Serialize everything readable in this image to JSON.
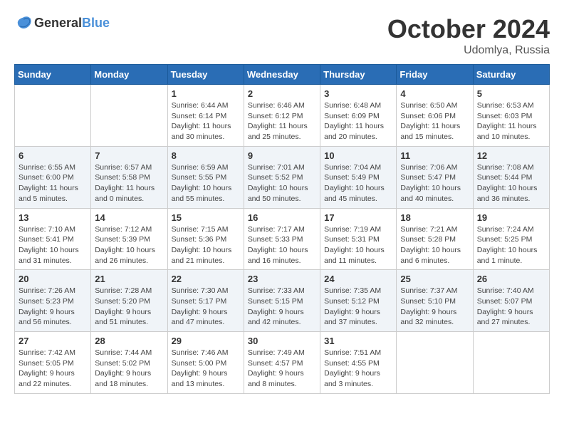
{
  "header": {
    "logo_general": "General",
    "logo_blue": "Blue",
    "month_title": "October 2024",
    "location": "Udomlya, Russia"
  },
  "days_of_week": [
    "Sunday",
    "Monday",
    "Tuesday",
    "Wednesday",
    "Thursday",
    "Friday",
    "Saturday"
  ],
  "weeks": [
    [
      {
        "day": "",
        "info": ""
      },
      {
        "day": "",
        "info": ""
      },
      {
        "day": "1",
        "info": "Sunrise: 6:44 AM\nSunset: 6:14 PM\nDaylight: 11 hours and 30 minutes."
      },
      {
        "day": "2",
        "info": "Sunrise: 6:46 AM\nSunset: 6:12 PM\nDaylight: 11 hours and 25 minutes."
      },
      {
        "day": "3",
        "info": "Sunrise: 6:48 AM\nSunset: 6:09 PM\nDaylight: 11 hours and 20 minutes."
      },
      {
        "day": "4",
        "info": "Sunrise: 6:50 AM\nSunset: 6:06 PM\nDaylight: 11 hours and 15 minutes."
      },
      {
        "day": "5",
        "info": "Sunrise: 6:53 AM\nSunset: 6:03 PM\nDaylight: 11 hours and 10 minutes."
      }
    ],
    [
      {
        "day": "6",
        "info": "Sunrise: 6:55 AM\nSunset: 6:00 PM\nDaylight: 11 hours and 5 minutes."
      },
      {
        "day": "7",
        "info": "Sunrise: 6:57 AM\nSunset: 5:58 PM\nDaylight: 11 hours and 0 minutes."
      },
      {
        "day": "8",
        "info": "Sunrise: 6:59 AM\nSunset: 5:55 PM\nDaylight: 10 hours and 55 minutes."
      },
      {
        "day": "9",
        "info": "Sunrise: 7:01 AM\nSunset: 5:52 PM\nDaylight: 10 hours and 50 minutes."
      },
      {
        "day": "10",
        "info": "Sunrise: 7:04 AM\nSunset: 5:49 PM\nDaylight: 10 hours and 45 minutes."
      },
      {
        "day": "11",
        "info": "Sunrise: 7:06 AM\nSunset: 5:47 PM\nDaylight: 10 hours and 40 minutes."
      },
      {
        "day": "12",
        "info": "Sunrise: 7:08 AM\nSunset: 5:44 PM\nDaylight: 10 hours and 36 minutes."
      }
    ],
    [
      {
        "day": "13",
        "info": "Sunrise: 7:10 AM\nSunset: 5:41 PM\nDaylight: 10 hours and 31 minutes."
      },
      {
        "day": "14",
        "info": "Sunrise: 7:12 AM\nSunset: 5:39 PM\nDaylight: 10 hours and 26 minutes."
      },
      {
        "day": "15",
        "info": "Sunrise: 7:15 AM\nSunset: 5:36 PM\nDaylight: 10 hours and 21 minutes."
      },
      {
        "day": "16",
        "info": "Sunrise: 7:17 AM\nSunset: 5:33 PM\nDaylight: 10 hours and 16 minutes."
      },
      {
        "day": "17",
        "info": "Sunrise: 7:19 AM\nSunset: 5:31 PM\nDaylight: 10 hours and 11 minutes."
      },
      {
        "day": "18",
        "info": "Sunrise: 7:21 AM\nSunset: 5:28 PM\nDaylight: 10 hours and 6 minutes."
      },
      {
        "day": "19",
        "info": "Sunrise: 7:24 AM\nSunset: 5:25 PM\nDaylight: 10 hours and 1 minute."
      }
    ],
    [
      {
        "day": "20",
        "info": "Sunrise: 7:26 AM\nSunset: 5:23 PM\nDaylight: 9 hours and 56 minutes."
      },
      {
        "day": "21",
        "info": "Sunrise: 7:28 AM\nSunset: 5:20 PM\nDaylight: 9 hours and 51 minutes."
      },
      {
        "day": "22",
        "info": "Sunrise: 7:30 AM\nSunset: 5:17 PM\nDaylight: 9 hours and 47 minutes."
      },
      {
        "day": "23",
        "info": "Sunrise: 7:33 AM\nSunset: 5:15 PM\nDaylight: 9 hours and 42 minutes."
      },
      {
        "day": "24",
        "info": "Sunrise: 7:35 AM\nSunset: 5:12 PM\nDaylight: 9 hours and 37 minutes."
      },
      {
        "day": "25",
        "info": "Sunrise: 7:37 AM\nSunset: 5:10 PM\nDaylight: 9 hours and 32 minutes."
      },
      {
        "day": "26",
        "info": "Sunrise: 7:40 AM\nSunset: 5:07 PM\nDaylight: 9 hours and 27 minutes."
      }
    ],
    [
      {
        "day": "27",
        "info": "Sunrise: 7:42 AM\nSunset: 5:05 PM\nDaylight: 9 hours and 22 minutes."
      },
      {
        "day": "28",
        "info": "Sunrise: 7:44 AM\nSunset: 5:02 PM\nDaylight: 9 hours and 18 minutes."
      },
      {
        "day": "29",
        "info": "Sunrise: 7:46 AM\nSunset: 5:00 PM\nDaylight: 9 hours and 13 minutes."
      },
      {
        "day": "30",
        "info": "Sunrise: 7:49 AM\nSunset: 4:57 PM\nDaylight: 9 hours and 8 minutes."
      },
      {
        "day": "31",
        "info": "Sunrise: 7:51 AM\nSunset: 4:55 PM\nDaylight: 9 hours and 3 minutes."
      },
      {
        "day": "",
        "info": ""
      },
      {
        "day": "",
        "info": ""
      }
    ]
  ]
}
